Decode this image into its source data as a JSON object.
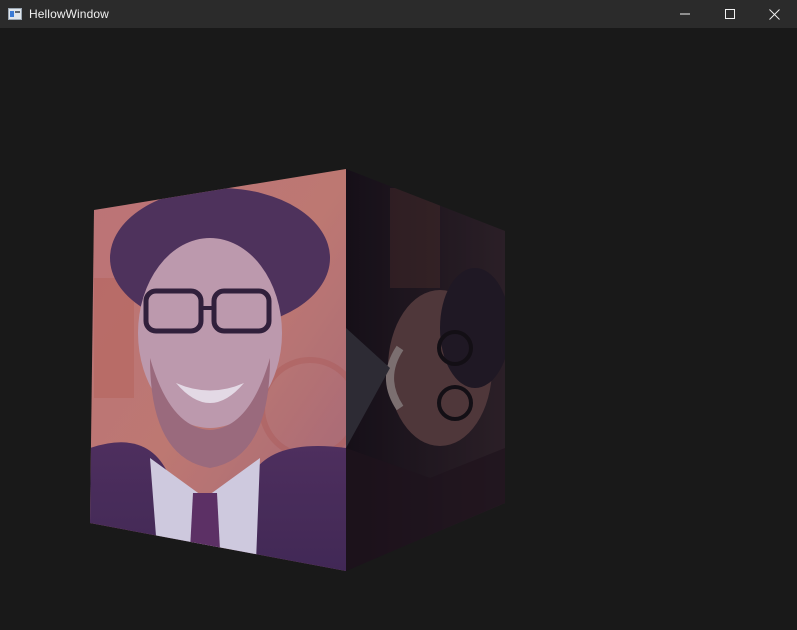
{
  "window": {
    "title": "HellowWindow",
    "controls": {
      "minimize": "minimize",
      "maximize": "maximize",
      "close": "close"
    }
  },
  "scene": {
    "background": "#191919",
    "object": "textured-cube",
    "texture": "portrait-photo",
    "front_face_tint": "#9a6a9a",
    "side_face_tint": "#3a2a3a"
  },
  "icons": {
    "app": "app-window-icon",
    "minimize": "minimize-icon",
    "maximize": "maximize-icon",
    "close": "close-icon"
  }
}
